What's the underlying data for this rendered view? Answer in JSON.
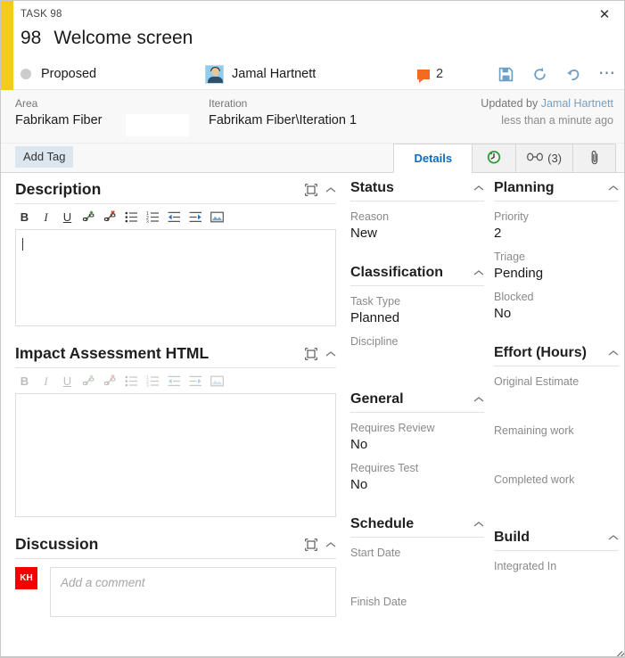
{
  "window": {
    "task_type_label": "TASK 98",
    "close_icon": "close-icon",
    "resize_grip": "resize-grip"
  },
  "header": {
    "accent_color": "#f2cb1d",
    "id": "98",
    "title": "Welcome screen",
    "state": "Proposed",
    "state_dot_color": "#cccccc",
    "assignee": "Jamal Hartnett",
    "comment_count": "2",
    "comment_icon_color": "#f26b21",
    "actions": [
      {
        "name": "save-icon",
        "label": "Save"
      },
      {
        "name": "refresh-icon",
        "label": "Refresh"
      },
      {
        "name": "undo-icon",
        "label": "Revert"
      },
      {
        "name": "more-icon",
        "label": "•••"
      }
    ]
  },
  "classification": {
    "area_label": "Area",
    "area_value": "Fabrikam Fiber",
    "iteration_label": "Iteration",
    "iteration_value": "Fabrikam Fiber\\Iteration 1",
    "updated_prefix": "Updated by ",
    "updated_by": "Jamal Hartnett",
    "updated_when": "less than a minute ago"
  },
  "tags": {
    "add_tag_label": "Add Tag"
  },
  "tabs": [
    {
      "name": "tab-details",
      "label": "Details",
      "active": true
    },
    {
      "name": "tab-history",
      "label": "",
      "icon": "history-clock-icon",
      "active": false
    },
    {
      "name": "tab-links",
      "label": "(3)",
      "icon": "link-icon",
      "active": false
    },
    {
      "name": "tab-attachments",
      "label": "",
      "icon": "paperclip-icon",
      "active": false
    }
  ],
  "editor_toolbar": {
    "buttons": [
      {
        "name": "bold-icon",
        "glyph": "B"
      },
      {
        "name": "italic-icon",
        "glyph": "I"
      },
      {
        "name": "underline-icon",
        "glyph": "U"
      },
      {
        "name": "insert-link-icon",
        "glyph": ""
      },
      {
        "name": "remove-link-icon",
        "glyph": ""
      },
      {
        "name": "bulleted-list-icon",
        "glyph": ""
      },
      {
        "name": "numbered-list-icon",
        "glyph": ""
      },
      {
        "name": "outdent-icon",
        "glyph": ""
      },
      {
        "name": "indent-icon",
        "glyph": ""
      },
      {
        "name": "insert-image-icon",
        "glyph": ""
      }
    ]
  },
  "sections": {
    "description": {
      "title": "Description",
      "value": ""
    },
    "impact": {
      "title": "Impact Assessment HTML",
      "value": ""
    },
    "discussion": {
      "title": "Discussion",
      "avatar_initials": "KH",
      "avatar_color": "#f20000",
      "comment_placeholder": "Add a comment"
    }
  },
  "middle_column": [
    {
      "title": "Status",
      "fields": [
        {
          "label": "Reason",
          "value": "New"
        }
      ]
    },
    {
      "title": "Classification",
      "fields": [
        {
          "label": "Task Type",
          "value": "Planned"
        },
        {
          "label": "Discipline",
          "value": ""
        }
      ]
    },
    {
      "title": "General",
      "fields": [
        {
          "label": "Requires Review",
          "value": "No"
        },
        {
          "label": "Requires Test",
          "value": "No"
        }
      ]
    },
    {
      "title": "Schedule",
      "fields": [
        {
          "label": "Start Date",
          "value": ""
        },
        {
          "label": "Finish Date",
          "value": ""
        }
      ]
    }
  ],
  "right_column": [
    {
      "title": "Planning",
      "fields": [
        {
          "label": "Priority",
          "value": "2"
        },
        {
          "label": "Triage",
          "value": "Pending"
        },
        {
          "label": "Blocked",
          "value": "No"
        }
      ]
    },
    {
      "title": "Effort (Hours)",
      "fields": [
        {
          "label": "Original Estimate",
          "value": ""
        },
        {
          "label": "Remaining work",
          "value": ""
        },
        {
          "label": "Completed work",
          "value": ""
        }
      ]
    },
    {
      "title": "Build",
      "fields": [
        {
          "label": "Integrated In",
          "value": ""
        }
      ]
    }
  ]
}
